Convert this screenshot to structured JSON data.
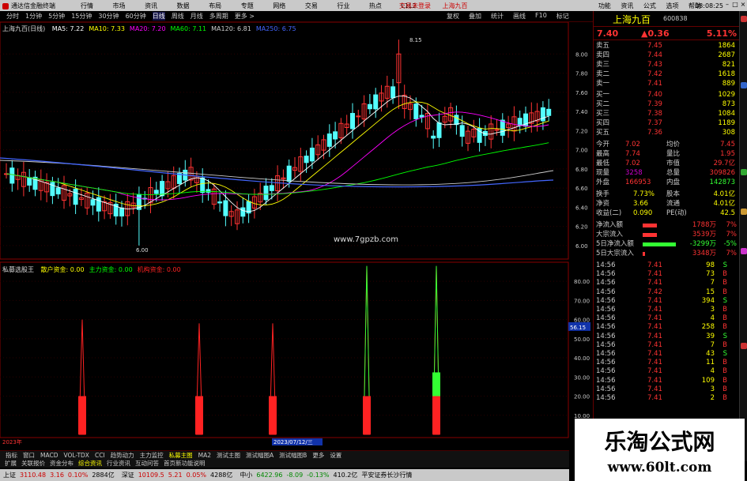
{
  "titlebar": {
    "app_name": "通达信金融终端",
    "menus": [
      "行情",
      "市场",
      "资讯",
      "数据",
      "布局",
      "专题",
      "网络",
      "交易",
      "行业",
      "热点",
      "L1L2"
    ],
    "center": [
      "交易未登录",
      "上海九百"
    ],
    "right": [
      "功能",
      "资讯",
      "公式",
      "选项",
      "帮助"
    ],
    "time": "08:08:25"
  },
  "toolbar": {
    "periods": [
      "分时",
      "1分钟",
      "5分钟",
      "15分钟",
      "30分钟",
      "60分钟",
      "日线",
      "周线",
      "月线",
      "多周期",
      "更多 >"
    ],
    "active": "日线",
    "right": [
      "复权",
      "叠加",
      "统计",
      "画线",
      "F10",
      "标记"
    ]
  },
  "main_chart": {
    "stock_label": "上海九百(日线)",
    "ma": [
      {
        "label": "MA5: 7.22",
        "color": "#ffffff"
      },
      {
        "label": "MA10: 7.33",
        "color": "#ffff00"
      },
      {
        "label": "MA20: 7.20",
        "color": "#ff00ff"
      },
      {
        "label": "MA60: 7.11",
        "color": "#00ff00"
      },
      {
        "label": "MA120: 6.81",
        "color": "#cccccc"
      },
      {
        "label": "MA250: 6.75",
        "color": "#4466ff"
      }
    ],
    "price_ticks": [
      "8.00",
      "7.80",
      "7.60",
      "7.40",
      "7.20",
      "7.00",
      "6.80",
      "6.60",
      "6.40",
      "6.20",
      "6.00"
    ],
    "high_label": "8.15",
    "low_label": "6.00",
    "site_watermark": "www.7gpzb.com"
  },
  "indicator": {
    "name": "私募选股王",
    "items": [
      {
        "label": "散户资金: 0.00",
        "color": "#ffff00"
      },
      {
        "label": "主力资金: 0.00",
        "color": "#00ff00"
      },
      {
        "label": "机构资金: 0.00",
        "color": "#ff2222"
      }
    ],
    "ticks": [
      "80.00",
      "70.00",
      "60.00",
      "50.00",
      "40.00",
      "30.00",
      "20.00",
      "10.00"
    ],
    "current_value": "56.15",
    "date_left": "2023年",
    "date_cursor": "2023/07/12/三"
  },
  "quote": {
    "name": "上海九百",
    "code": "600838",
    "price": "7.40",
    "change": "▲0.36",
    "pct": "5.11%",
    "sells": [
      {
        "label": "卖五",
        "price": "7.45",
        "vol": "1864"
      },
      {
        "label": "卖四",
        "price": "7.44",
        "vol": "2687"
      },
      {
        "label": "卖三",
        "price": "7.43",
        "vol": "821"
      },
      {
        "label": "卖二",
        "price": "7.42",
        "vol": "1618"
      },
      {
        "label": "卖一",
        "price": "7.41",
        "vol": "889"
      }
    ],
    "buys": [
      {
        "label": "买一",
        "price": "7.40",
        "vol": "1029"
      },
      {
        "label": "买二",
        "price": "7.39",
        "vol": "873"
      },
      {
        "label": "买三",
        "price": "7.38",
        "vol": "1084"
      },
      {
        "label": "买四",
        "price": "7.37",
        "vol": "1189"
      },
      {
        "label": "买五",
        "price": "7.36",
        "vol": "308"
      }
    ],
    "stats": [
      {
        "k1": "今开",
        "v1": "7.02",
        "k2": "均价",
        "v2": "7.45"
      },
      {
        "k1": "最高",
        "v1": "7.74",
        "k2": "量比",
        "v2": "1.95"
      },
      {
        "k1": "最低",
        "v1": "7.02",
        "k2": "市值",
        "v2": "29.7亿"
      },
      {
        "k1": "现量",
        "v1": "3258",
        "k2": "总量",
        "v2": "309826"
      },
      {
        "k1": "外盘",
        "v1": "166953",
        "k2": "内盘",
        "v2": "142873"
      }
    ],
    "stats2": [
      {
        "k1": "换手",
        "v1": "7.73%",
        "k2": "股本",
        "v2": "4.01亿"
      },
      {
        "k1": "净资",
        "v1": "3.66",
        "k2": "流通",
        "v2": "4.01亿"
      },
      {
        "k1": "收益(二)",
        "v1": "0.090",
        "k2": "PE(动)",
        "v2": "42.5"
      }
    ],
    "flows": [
      {
        "label": "净流入额",
        "value": "1788万",
        "pct": "7%",
        "bar_color": "#ff3333",
        "bar_fraction": 0.3
      },
      {
        "label": "大宗流入",
        "value": "3539万",
        "pct": "7%",
        "bar_color": "#ff3333",
        "bar_fraction": 0.3
      },
      {
        "label": "5日净流入额",
        "value": "-3299万",
        "pct": "-5%",
        "bar_color": "#33ff33",
        "bar_fraction": 0.7
      },
      {
        "label": "5日大宗流入",
        "value": "3348万",
        "pct": "7%",
        "bar_color": "#ff3333",
        "bar_fraction": 0.05
      }
    ],
    "ticks": [
      {
        "t": "14:56",
        "p": "7.41",
        "v": "98",
        "d": "S"
      },
      {
        "t": "14:56",
        "p": "7.41",
        "v": "73",
        "d": "B"
      },
      {
        "t": "14:56",
        "p": "7.41",
        "v": "7",
        "d": "B"
      },
      {
        "t": "14:56",
        "p": "7.42",
        "v": "15",
        "d": "B"
      },
      {
        "t": "14:56",
        "p": "7.41",
        "v": "394",
        "d": "S"
      },
      {
        "t": "14:56",
        "p": "7.41",
        "v": "3",
        "d": "B"
      },
      {
        "t": "14:56",
        "p": "7.41",
        "v": "4",
        "d": "B"
      },
      {
        "t": "14:56",
        "p": "7.41",
        "v": "258",
        "d": "B"
      },
      {
        "t": "14:56",
        "p": "7.41",
        "v": "39",
        "d": "S"
      },
      {
        "t": "14:56",
        "p": "7.41",
        "v": "7",
        "d": "B"
      },
      {
        "t": "14:56",
        "p": "7.41",
        "v": "43",
        "d": "S"
      },
      {
        "t": "14:56",
        "p": "7.41",
        "v": "11",
        "d": "B"
      },
      {
        "t": "14:56",
        "p": "7.41",
        "v": "4",
        "d": "B"
      },
      {
        "t": "14:56",
        "p": "7.41",
        "v": "109",
        "d": "B"
      },
      {
        "t": "14:56",
        "p": "7.41",
        "v": "3",
        "d": "B"
      },
      {
        "t": "14:56",
        "p": "7.41",
        "v": "2",
        "d": "B"
      }
    ]
  },
  "indicator_tabs": [
    "指标",
    "窗口",
    "MACD",
    "VOL-TDX",
    "CCI",
    "趋势动力",
    "主力监控",
    "私募主图",
    "MA2",
    "测试主图",
    "测试幅图A",
    "测试幅图B",
    "更多",
    "设置"
  ],
  "indicator_active": "私募主图",
  "extra_tabs": [
    "扩展",
    "关联报价",
    "资金分布",
    "综合资讯",
    "行业资讯",
    "互动问答",
    "首页新功能说明"
  ],
  "statusbar": [
    {
      "text": "上证",
      "color": "#000"
    },
    {
      "text": "3110.48",
      "color": "#c00"
    },
    {
      "text": "3.16",
      "color": "#c00"
    },
    {
      "text": "0.10%",
      "color": "#c00"
    },
    {
      "text": "2884亿",
      "color": "#000"
    },
    {
      "text": "深证",
      "color": "#000"
    },
    {
      "text": "10109.5",
      "color": "#c00"
    },
    {
      "text": "5.21",
      "color": "#c00"
    },
    {
      "text": "0.05%",
      "color": "#c00"
    },
    {
      "text": "4288亿",
      "color": "#000"
    },
    {
      "text": "中小",
      "color": "#000"
    },
    {
      "text": "6422.96",
      "color": "#080"
    },
    {
      "text": "-8.09",
      "color": "#080"
    },
    {
      "text": "-0.13%",
      "color": "#080"
    },
    {
      "text": "410.2亿",
      "color": "#000"
    },
    {
      "text": "平安证券长沙行情",
      "color": "#000"
    }
  ],
  "watermark": {
    "line1": "乐淘公式网",
    "line2": "www.60lt.com"
  }
}
